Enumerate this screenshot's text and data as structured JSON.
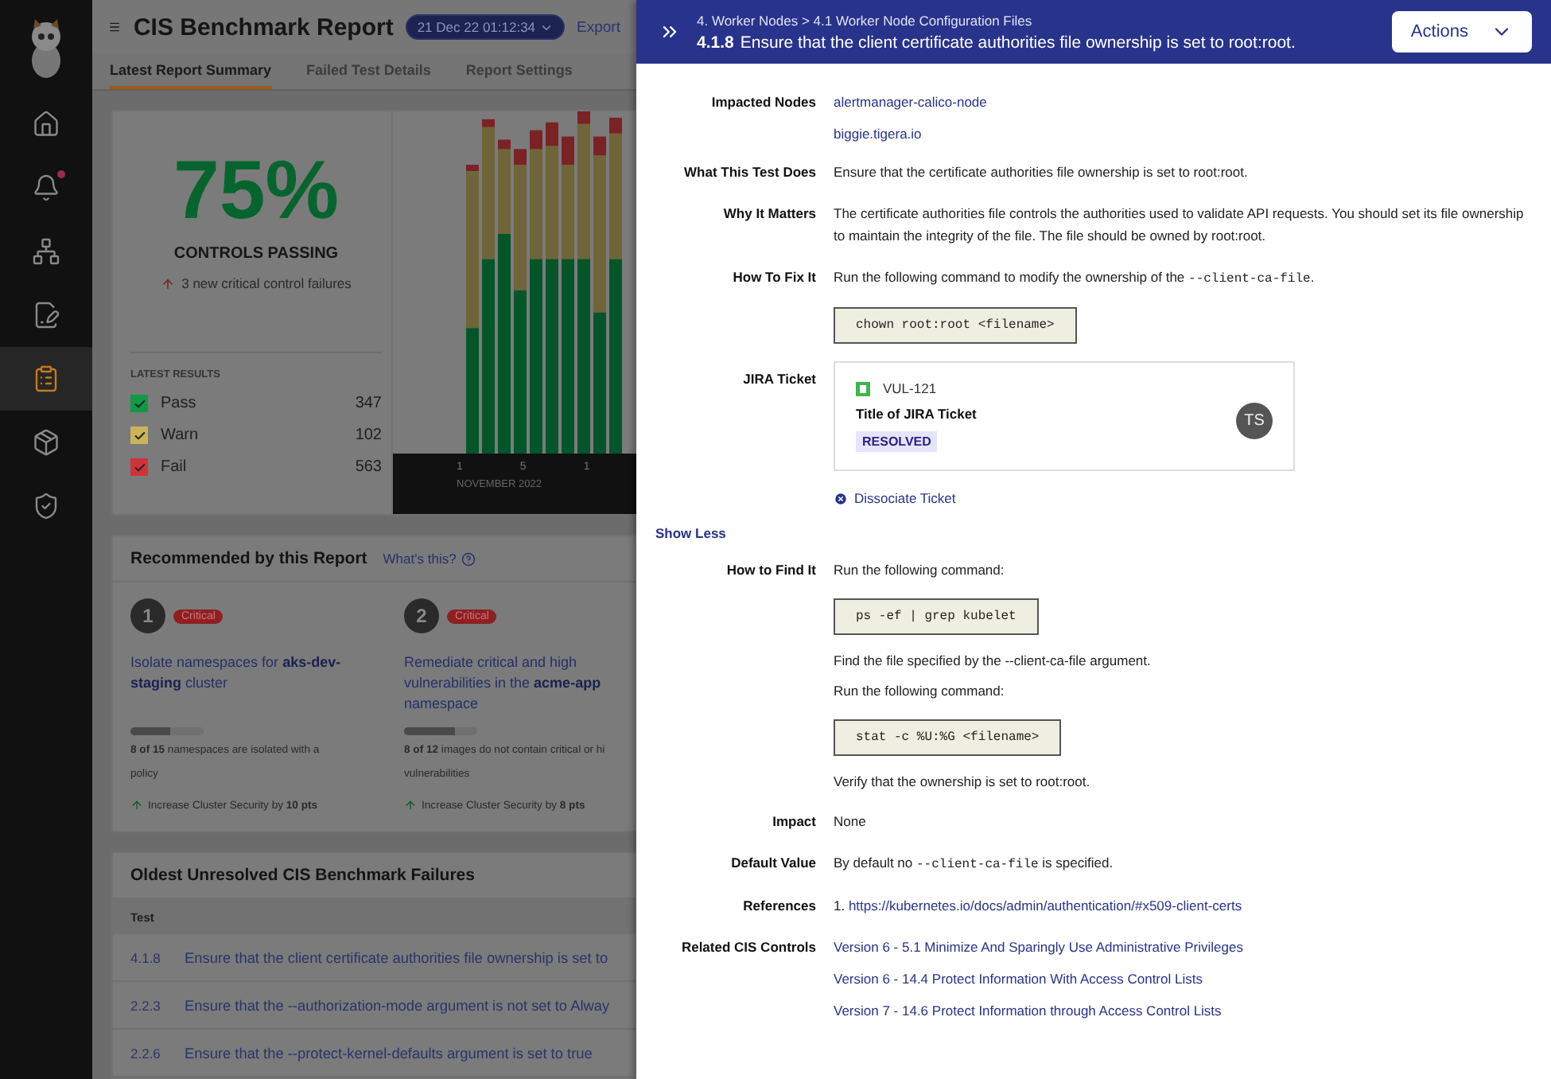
{
  "sidebar": {
    "items": [
      {
        "selected": false,
        "badge": false
      },
      {
        "selected": false,
        "badge": true
      },
      {
        "selected": false,
        "badge": false
      },
      {
        "selected": false,
        "badge": false
      },
      {
        "selected": true,
        "badge": false
      },
      {
        "selected": false,
        "badge": false
      },
      {
        "selected": false,
        "badge": false
      }
    ]
  },
  "header": {
    "title": "CIS Benchmark Report",
    "date": "21 Dec 22 01:12:34",
    "export": "Export"
  },
  "tabs": [
    {
      "label": "Latest Report Summary",
      "selected": true
    },
    {
      "label": "Failed Test Details",
      "selected": false
    },
    {
      "label": "Report Settings",
      "selected": false
    }
  ],
  "summary": {
    "percent": "75%",
    "caption": "CONTROLS PASSING",
    "trend": "3 new critical control failures",
    "results_title": "LATEST RESULTS",
    "results": [
      {
        "label": "Pass",
        "count": "347",
        "color": "#0f9a47"
      },
      {
        "label": "Warn",
        "count": "102",
        "color": "#cbb35a"
      },
      {
        "label": "Fail",
        "count": "563",
        "color": "#d0323a"
      }
    ],
    "chart": {
      "ticks": [
        "1",
        "5",
        "1"
      ],
      "month": "NOVEMBER 2022"
    }
  },
  "recommended": {
    "title": "Recommended by this Report",
    "help": "What's this?",
    "items": [
      {
        "number": "1",
        "severity": "Critical",
        "title": "Isolate namespaces for **aks-dev-staging** cluster",
        "level": 0.55,
        "lines": [
          "**8 of 15** namespaces are isolated with a",
          "policy"
        ],
        "gain": "Increase Cluster Security by **10 pts**"
      },
      {
        "number": "2",
        "severity": "Critical",
        "title": "Remediate critical and high vulnerabilities in the **acme-app** namespace",
        "level": 0.7,
        "lines": [
          "**8 of 12** images do not contain critical or hi",
          "vulnerabilities"
        ],
        "gain": "Increase Cluster Security by **8 pts**"
      }
    ]
  },
  "failures": {
    "title": "Oldest Unresolved CIS Benchmark Failures",
    "column": "Test",
    "rows": [
      {
        "id": "4.1.8",
        "text": "Ensure that the client certificate authorities file ownership is set to"
      },
      {
        "id": "2.2.3",
        "text": "Ensure that the --authorization-mode argument is not set to Alway"
      },
      {
        "id": "2.2.6",
        "text": "Ensure that the --protect-kernel-defaults argument is set to true"
      }
    ]
  },
  "drawer": {
    "breadcrumb": "4. Worker Nodes > 4.1 Worker Node Configuration Files",
    "id": "4.1.8",
    "title": "Ensure that the client certificate authorities file ownership is set to root:root.",
    "actions": "Actions",
    "sections": [
      {
        "kind": "row",
        "label": "Impacted Nodes",
        "blocks": [
          {
            "kind": "links",
            "items": [
              "alertmanager-calico-node",
              "biggie.tigera.io"
            ]
          }
        ]
      },
      {
        "kind": "row",
        "label": "What This Test Does",
        "blocks": [
          {
            "kind": "paragraph",
            "segments": [
              {
                "kind": "text",
                "text": "Ensure that the certificate authorities file ownership is set to root:root."
              }
            ]
          }
        ]
      },
      {
        "kind": "row",
        "label": "Why It Matters",
        "blocks": [
          {
            "kind": "paragraph",
            "segments": [
              {
                "kind": "text",
                "text": "The certificate authorities file controls the authorities used to validate API requests. You should set its file ownership to maintain the integrity of the file. The file should be owned by root:root."
              }
            ]
          }
        ]
      },
      {
        "kind": "row",
        "label": "How To Fix It",
        "blocks": [
          {
            "kind": "paragraph",
            "segments": [
              {
                "kind": "text",
                "text": "Run the following command to modify the ownership of the "
              },
              {
                "kind": "code",
                "text": "--client-ca-file"
              },
              {
                "kind": "text",
                "text": "."
              }
            ]
          },
          {
            "kind": "command",
            "text": "chown root:root <filename>"
          }
        ]
      },
      {
        "kind": "row",
        "label": "JIRA Ticket",
        "blocks": [
          {
            "kind": "ticket",
            "key": "VUL-121",
            "title": "Title of JIRA Ticket",
            "status": "RESOLVED",
            "assignee": "TS"
          },
          {
            "kind": "action",
            "text": "Dissociate Ticket"
          }
        ]
      },
      {
        "kind": "toggle",
        "text": "Show Less"
      },
      {
        "kind": "row",
        "label": "How to Find It",
        "blocks": [
          {
            "kind": "paragraph",
            "segments": [
              {
                "kind": "text",
                "text": "Run the following command:"
              }
            ]
          },
          {
            "kind": "command",
            "text": "ps -ef | grep kubelet"
          },
          {
            "kind": "paragraph",
            "segments": [
              {
                "kind": "text",
                "text": "Find the file specified by the --client-ca-file argument."
              }
            ]
          },
          {
            "kind": "paragraph",
            "segments": [
              {
                "kind": "text",
                "text": "Run the following command:"
              }
            ]
          },
          {
            "kind": "command",
            "text": "stat -c %U:%G <filename>"
          },
          {
            "kind": "paragraph",
            "segments": [
              {
                "kind": "text",
                "text": "Verify that the ownership is set to root:root."
              }
            ]
          }
        ]
      },
      {
        "kind": "row",
        "label": "Impact",
        "blocks": [
          {
            "kind": "paragraph",
            "segments": [
              {
                "kind": "text",
                "text": "None"
              }
            ]
          }
        ]
      },
      {
        "kind": "row",
        "label": "Default Value",
        "blocks": [
          {
            "kind": "paragraph",
            "segments": [
              {
                "kind": "text",
                "text": "By default no "
              },
              {
                "kind": "code",
                "text": "--client-ca-file"
              },
              {
                "kind": "text",
                "text": " is specified."
              }
            ]
          }
        ]
      },
      {
        "kind": "row",
        "label": "References",
        "blocks": [
          {
            "kind": "paragraph",
            "segments": [
              {
                "kind": "text",
                "text": "1. "
              },
              {
                "kind": "link",
                "text": "https://kubernetes.io/docs/admin/authentication/#x509-client-certs"
              }
            ]
          }
        ]
      },
      {
        "kind": "row",
        "label": "Related CIS Controls",
        "blocks": [
          {
            "kind": "links",
            "items": [
              "Version 6 - 5.1 Minimize And Sparingly Use Administrative Privileges",
              "Version 6 - 14.4 Protect Information With Access Control Lists",
              "Version 7 - 14.6 Protect Information through Access Control Lists"
            ]
          }
        ]
      }
    ]
  }
}
